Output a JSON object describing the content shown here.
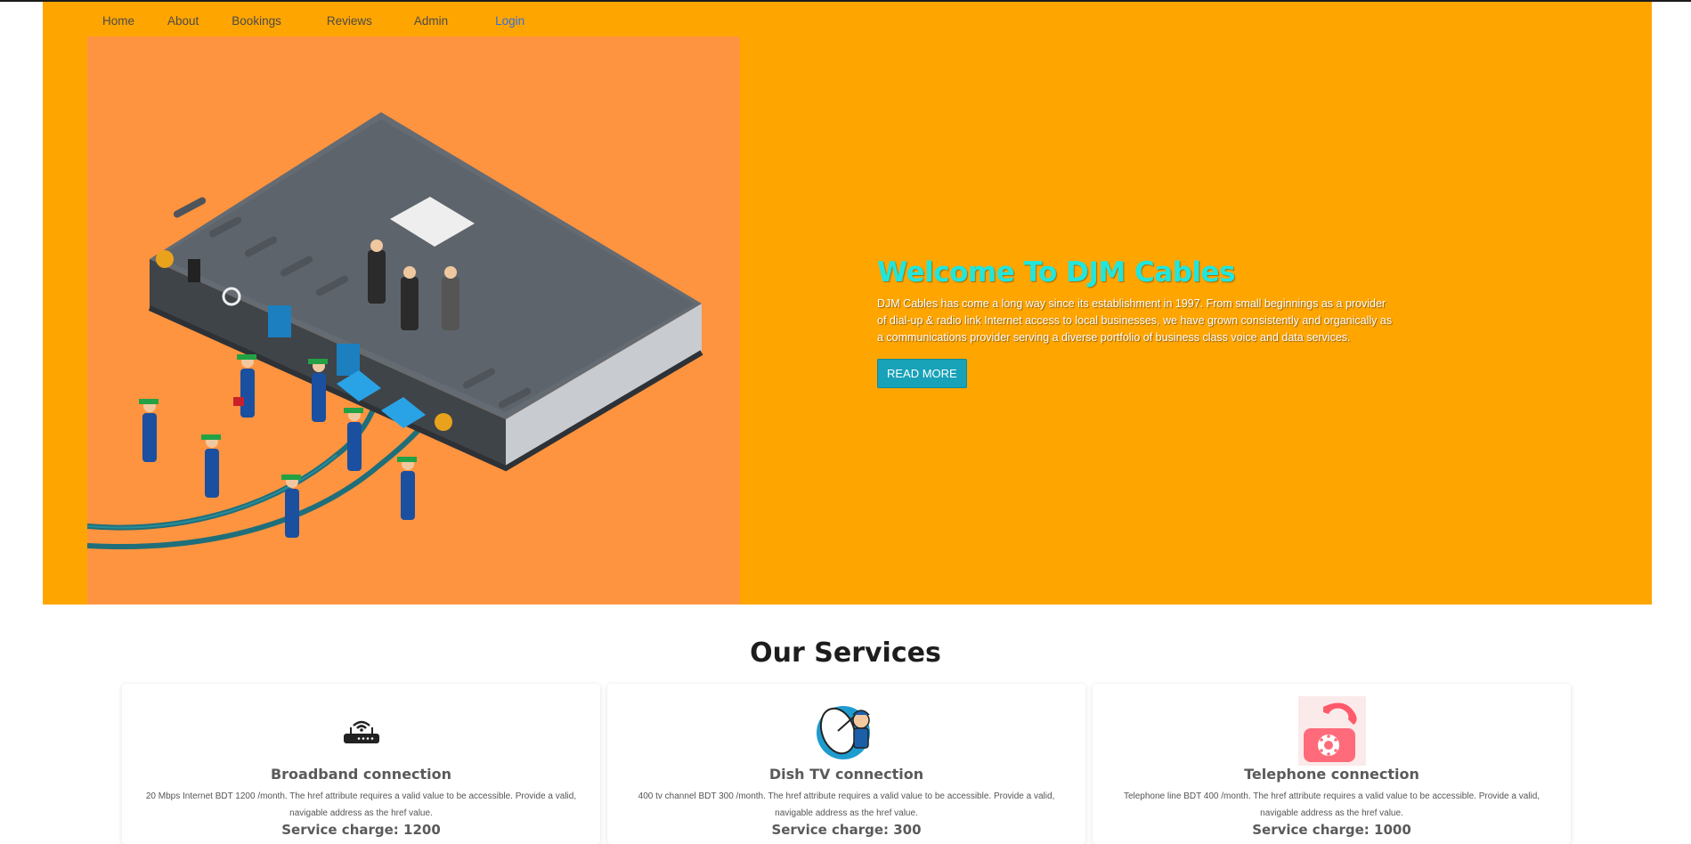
{
  "nav": {
    "items": [
      {
        "label": "Home"
      },
      {
        "label": "About"
      },
      {
        "label": "Bookings"
      },
      {
        "label": "Reviews"
      },
      {
        "label": "Admin"
      },
      {
        "label": "Login"
      }
    ]
  },
  "hero": {
    "title": "Welcome To DJM Cables",
    "description": "DJM Cables has come a long way since its establishment in 1997. From small beginnings as a provider of dial-up & radio link Internet access to local businesses, we have grown consistently and organically as a communications provider serving a diverse portfolio of business class voice and data services.",
    "button_label": "READ MORE",
    "illustration": "router-technicians-illustration"
  },
  "services": {
    "title": "Our Services",
    "cards": [
      {
        "icon": "router-icon",
        "title": "Broadband connection",
        "description": "20 Mbps Internet BDT 1200 /month. The href attribute requires a valid value to be accessible. Provide a valid, navigable address as the href value.",
        "charge": "Service charge: 1200"
      },
      {
        "icon": "satellite-dish-icon",
        "title": "Dish TV connection",
        "description": "400 tv channel BDT 300 /month. The href attribute requires a valid value to be accessible. Provide a valid, navigable address as the href value.",
        "charge": "Service charge: 300"
      },
      {
        "icon": "telephone-icon",
        "title": "Telephone connection",
        "description": "Telephone line BDT 400 /month. The href attribute requires a valid value to be accessible. Provide a valid, navigable address as the href value.",
        "charge": "Service charge: 1000"
      }
    ]
  },
  "colors": {
    "hero_bg": "#ffa500",
    "illustration_bg": "#ff9440",
    "title_accent": "#20e6dd",
    "button": "#17a2b8",
    "login_link": "#2f6fe0"
  }
}
